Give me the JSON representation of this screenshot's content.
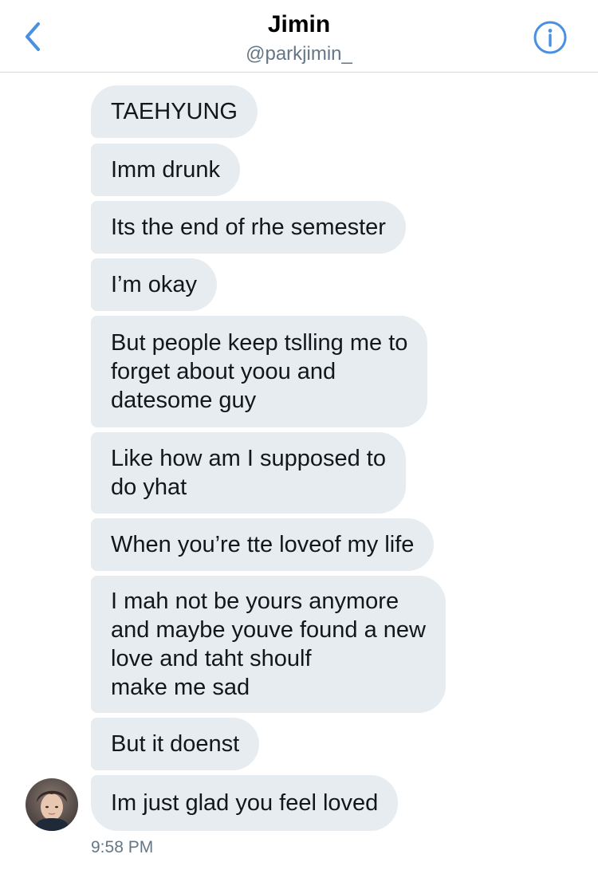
{
  "header": {
    "title": "Jimin",
    "handle": "@parkjimin_",
    "back_icon": "chevron-left-icon",
    "info_icon": "info-icon",
    "accent_color": "#4a90e2"
  },
  "messages": [
    {
      "text": "TAEHYUNG"
    },
    {
      "text": "Imm drunk"
    },
    {
      "text": "Its the end of rhe semester"
    },
    {
      "text": "I’m okay"
    },
    {
      "text": "But people keep tslling me to\nforget about yoou and\ndatesome guy"
    },
    {
      "text": "Like how am I supposed to\ndo yhat"
    },
    {
      "text": "When you’re tte loveof my life"
    },
    {
      "text": "I mah not be yours anymore\nand maybe youve found a new\nlove and taht shoulf\nmake me sad"
    },
    {
      "text": "But it doenst"
    },
    {
      "text": "Im just glad you feel loved"
    }
  ],
  "timestamp": "9:58 PM",
  "colors": {
    "bubble": "#e6ecf0",
    "text": "#14171a",
    "secondary_text": "#657786"
  }
}
